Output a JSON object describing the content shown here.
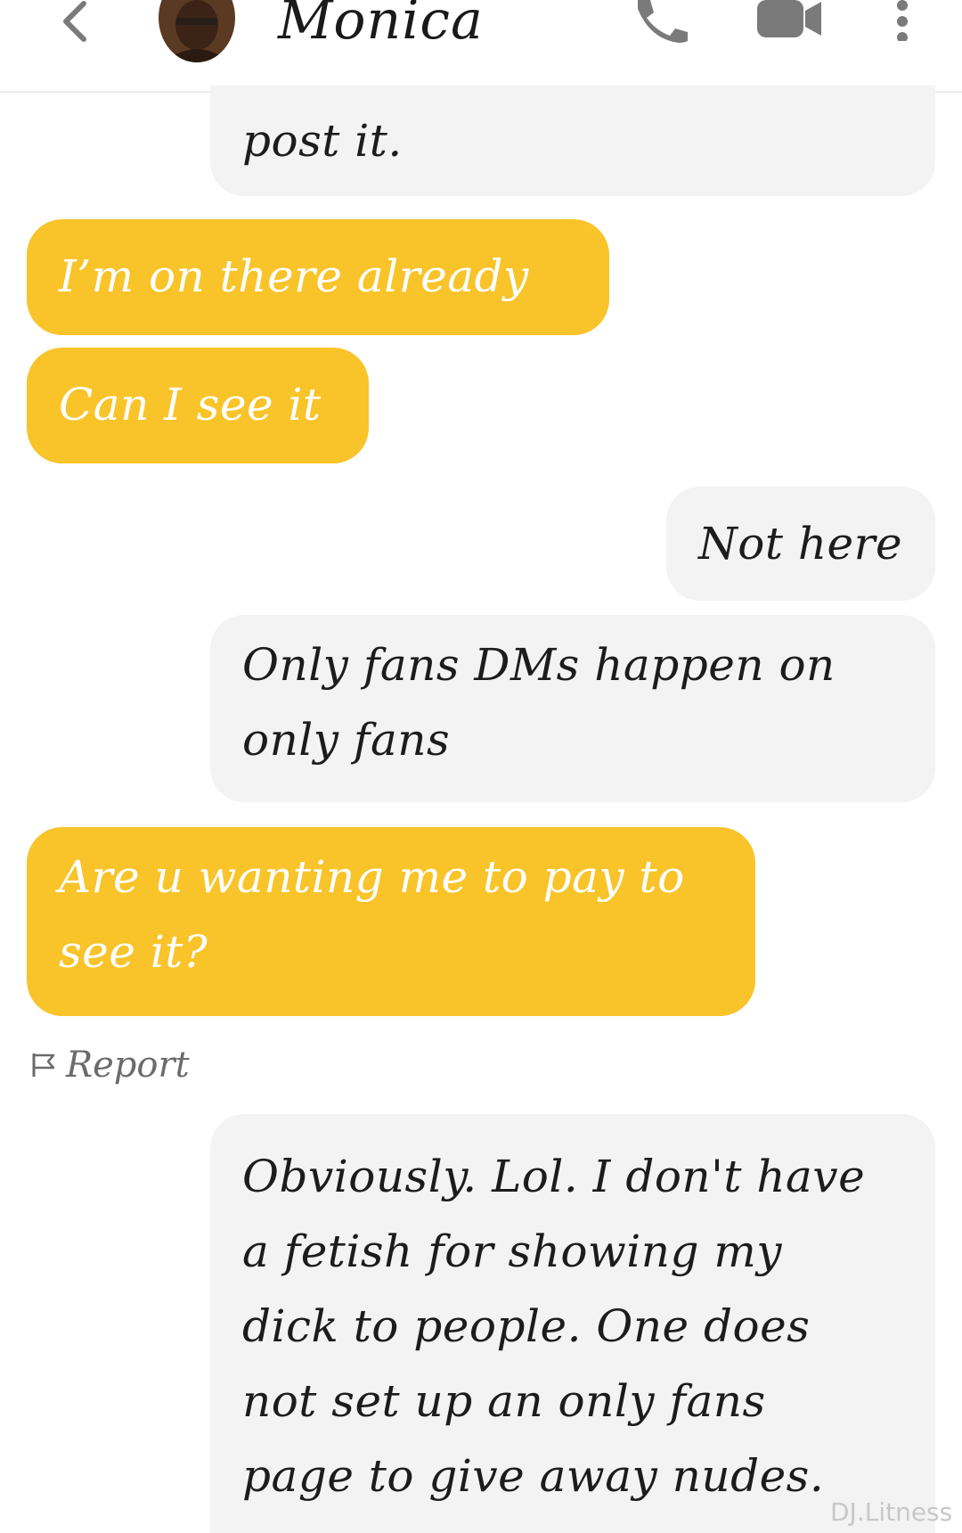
{
  "header": {
    "back_icon": "chevron-left-icon",
    "contact_name": "Monica",
    "call_icon": "phone-icon",
    "video_icon": "video-camera-icon",
    "more_icon": "more-vertical-icon"
  },
  "messages": [
    {
      "direction": "incoming",
      "lines": [
        "post it."
      ]
    },
    {
      "direction": "outgoing",
      "lines": [
        "I’m on there already"
      ]
    },
    {
      "direction": "outgoing",
      "lines": [
        "Can I see it"
      ]
    },
    {
      "direction": "incoming",
      "lines": [
        "Not here"
      ]
    },
    {
      "direction": "incoming",
      "lines": [
        "Only fans DMs happen on",
        "only fans"
      ]
    },
    {
      "direction": "outgoing",
      "lines": [
        "Are u wanting me to pay to",
        "see it?"
      ]
    },
    {
      "direction": "incoming",
      "lines": [
        "Obviously. Lol. I don't have",
        "a fetish for showing my",
        "dick to people. One does",
        "not set up an only fans",
        "page to give away nudes."
      ]
    }
  ],
  "report": {
    "icon": "flag-icon",
    "label": "Report"
  },
  "watermark": "DJ.Litness",
  "colors": {
    "outgoing_bubble": "#f8c42a",
    "incoming_bubble": "#f3f3f3",
    "outgoing_text": "#ffffff",
    "incoming_text": "#1c1c1c",
    "report_text": "#6b6b6b"
  }
}
